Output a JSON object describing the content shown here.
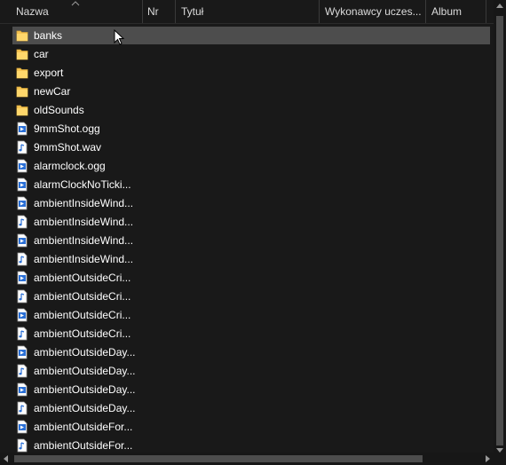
{
  "columns": [
    {
      "key": "name",
      "label": "Nazwa"
    },
    {
      "key": "nr",
      "label": "Nr"
    },
    {
      "key": "title",
      "label": "Tytuł"
    },
    {
      "key": "artists",
      "label": "Wykonawcy uczes..."
    },
    {
      "key": "album",
      "label": "Album"
    }
  ],
  "files": [
    {
      "name": "banks",
      "type": "folder-icon",
      "selected": true
    },
    {
      "name": "car",
      "type": "folder-icon"
    },
    {
      "name": "export",
      "type": "folder-icon"
    },
    {
      "name": "newCar",
      "type": "folder-icon"
    },
    {
      "name": "oldSounds",
      "type": "folder-icon"
    },
    {
      "name": "9mmShot.ogg",
      "type": "media-file-icon"
    },
    {
      "name": "9mmShot.wav",
      "type": "audio-file-icon"
    },
    {
      "name": "alarmclock.ogg",
      "type": "media-file-icon"
    },
    {
      "name": "alarmClockNoTicki...",
      "type": "media-file-icon"
    },
    {
      "name": "ambientInsideWind...",
      "type": "media-file-icon"
    },
    {
      "name": "ambientInsideWind...",
      "type": "audio-file-icon"
    },
    {
      "name": "ambientInsideWind...",
      "type": "media-file-icon"
    },
    {
      "name": "ambientInsideWind...",
      "type": "audio-file-icon"
    },
    {
      "name": "ambientOutsideCri...",
      "type": "media-file-icon"
    },
    {
      "name": "ambientOutsideCri...",
      "type": "audio-file-icon"
    },
    {
      "name": "ambientOutsideCri...",
      "type": "media-file-icon"
    },
    {
      "name": "ambientOutsideCri...",
      "type": "audio-file-icon"
    },
    {
      "name": "ambientOutsideDay...",
      "type": "media-file-icon"
    },
    {
      "name": "ambientOutsideDay...",
      "type": "audio-file-icon"
    },
    {
      "name": "ambientOutsideDay...",
      "type": "media-file-icon"
    },
    {
      "name": "ambientOutsideDay...",
      "type": "audio-file-icon"
    },
    {
      "name": "ambientOutsideFor...",
      "type": "media-file-icon"
    },
    {
      "name": "ambientOutsideFor...",
      "type": "audio-file-icon"
    }
  ],
  "colors": {
    "background": "#191919",
    "selected": "#4d4d4d",
    "folder": "#f6c453",
    "file_accent": "#2a6fd6"
  }
}
